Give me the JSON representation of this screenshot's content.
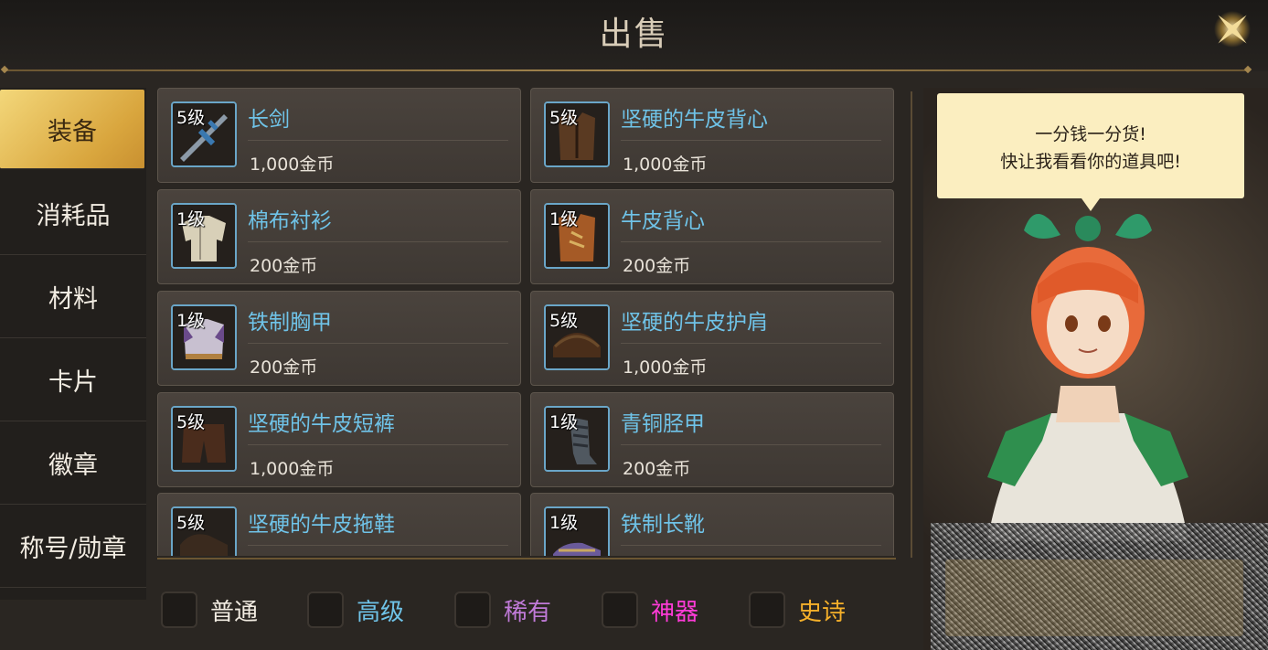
{
  "title": "出售",
  "sidebar": {
    "items": [
      {
        "label": "装备"
      },
      {
        "label": "消耗品"
      },
      {
        "label": "材料"
      },
      {
        "label": "卡片"
      },
      {
        "label": "徽章"
      },
      {
        "label": "称号/勋章"
      }
    ],
    "active_index": 0
  },
  "items": [
    {
      "level": "5级",
      "name": "长剑",
      "price": "1,000金币",
      "icon": "sword-icon"
    },
    {
      "level": "5级",
      "name": "坚硬的牛皮背心",
      "price": "1,000金币",
      "icon": "leather-vest-icon"
    },
    {
      "level": "1级",
      "name": "棉布衬衫",
      "price": "200金币",
      "icon": "cloth-shirt-icon"
    },
    {
      "level": "1级",
      "name": "牛皮背心",
      "price": "200金币",
      "icon": "vest-icon"
    },
    {
      "level": "1级",
      "name": "铁制胸甲",
      "price": "200金币",
      "icon": "breastplate-icon"
    },
    {
      "level": "5级",
      "name": "坚硬的牛皮护肩",
      "price": "1,000金币",
      "icon": "shoulder-icon"
    },
    {
      "level": "5级",
      "name": "坚硬的牛皮短裤",
      "price": "1,000金币",
      "icon": "pants-icon"
    },
    {
      "level": "1级",
      "name": "青铜胫甲",
      "price": "200金币",
      "icon": "greaves-icon"
    },
    {
      "level": "5级",
      "name": "坚硬的牛皮拖鞋",
      "price": "",
      "icon": "shoes-icon"
    },
    {
      "level": "1级",
      "name": "铁制长靴",
      "price": "",
      "icon": "boots-icon"
    }
  ],
  "filters": [
    {
      "label": "普通",
      "color": "#f2ece2"
    },
    {
      "label": "高级",
      "color": "#6fc3e8"
    },
    {
      "label": "稀有",
      "color": "#c07ad8"
    },
    {
      "label": "神器",
      "color": "#ff3bd8"
    },
    {
      "label": "史诗",
      "color": "#f5b02a"
    }
  ],
  "npc": {
    "line1": "一分钱一分货!",
    "line2": "快让我看看你的道具吧!"
  }
}
